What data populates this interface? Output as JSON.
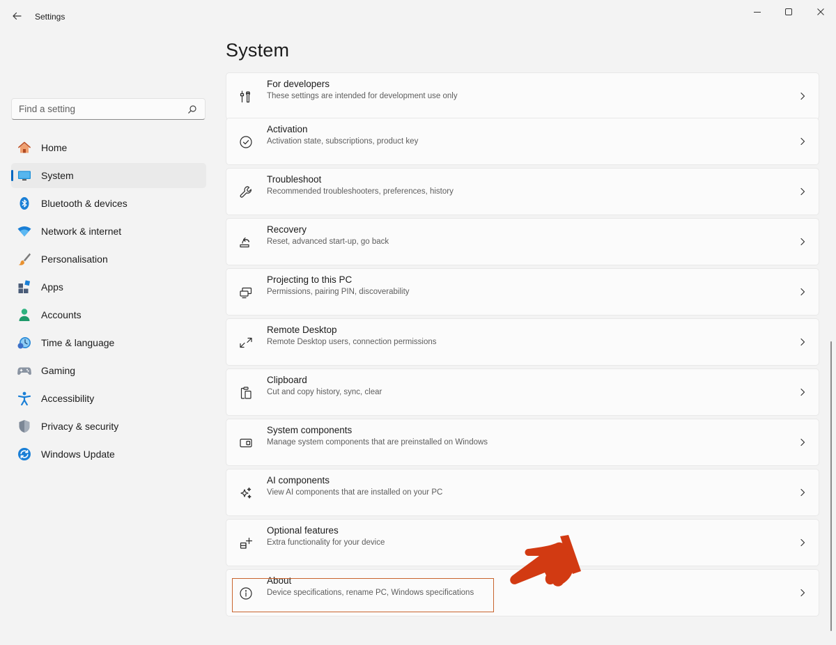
{
  "window": {
    "title": "Settings"
  },
  "sidebar": {
    "search": {
      "placeholder": "Find a setting",
      "value": ""
    },
    "items": [
      {
        "label": "Home",
        "icon": "home-icon"
      },
      {
        "label": "System",
        "icon": "system-icon",
        "active": true
      },
      {
        "label": "Bluetooth & devices",
        "icon": "bluetooth-icon"
      },
      {
        "label": "Network & internet",
        "icon": "wifi-icon"
      },
      {
        "label": "Personalisation",
        "icon": "brush-icon"
      },
      {
        "label": "Apps",
        "icon": "apps-icon"
      },
      {
        "label": "Accounts",
        "icon": "accounts-icon"
      },
      {
        "label": "Time & language",
        "icon": "clock-globe-icon"
      },
      {
        "label": "Gaming",
        "icon": "gamepad-icon"
      },
      {
        "label": "Accessibility",
        "icon": "accessibility-icon"
      },
      {
        "label": "Privacy & security",
        "icon": "shield-icon"
      },
      {
        "label": "Windows Update",
        "icon": "update-icon"
      }
    ]
  },
  "main": {
    "title": "System",
    "cards": [
      {
        "title": "For developers",
        "desc": "These settings are intended for development use only",
        "icon": "developer-tools-icon"
      },
      {
        "title": "Activation",
        "desc": "Activation state, subscriptions, product key",
        "icon": "check-circle-icon"
      },
      {
        "title": "Troubleshoot",
        "desc": "Recommended troubleshooters, preferences, history",
        "icon": "wrench-icon"
      },
      {
        "title": "Recovery",
        "desc": "Reset, advanced start-up, go back",
        "icon": "recovery-icon"
      },
      {
        "title": "Projecting to this PC",
        "desc": "Permissions, pairing PIN, discoverability",
        "icon": "projecting-icon"
      },
      {
        "title": "Remote Desktop",
        "desc": "Remote Desktop users, connection permissions",
        "icon": "remote-desktop-icon"
      },
      {
        "title": "Clipboard",
        "desc": "Cut and copy history, sync, clear",
        "icon": "clipboard-icon"
      },
      {
        "title": "System components",
        "desc": "Manage system components that are preinstalled on Windows",
        "icon": "components-icon"
      },
      {
        "title": "AI components",
        "desc": "View AI components that are installed on your PC",
        "icon": "sparkle-icon"
      },
      {
        "title": "Optional features",
        "desc": "Extra functionality for your device",
        "icon": "add-grid-icon"
      },
      {
        "title": "About",
        "desc": "Device specifications, rename PC, Windows specifications",
        "icon": "info-icon",
        "highlighted": true
      }
    ]
  },
  "colors": {
    "accent": "#0067c0",
    "highlight_border": "#c8642d",
    "pointer_hand": "#d23a12"
  }
}
